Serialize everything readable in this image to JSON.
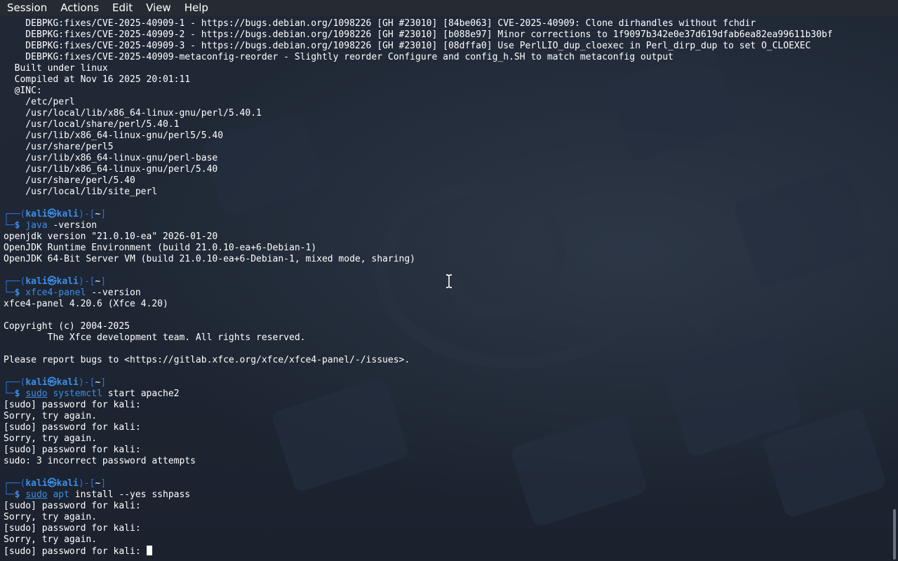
{
  "menubar": {
    "items": [
      "Session",
      "Actions",
      "Edit",
      "View",
      "Help"
    ]
  },
  "colors": {
    "menubar_bg": "#262b33",
    "terminal_text": "#ffffff",
    "prompt_accent": "#2f6fd6",
    "command_accent": "#3d8ee8"
  },
  "icons": {
    "text_cursor": "ibeam-mouse-cursor-icon",
    "terminal_cursor": "block-cursor-icon"
  },
  "terminal": {
    "lines": [
      {
        "t": "plain",
        "text": "    DEBPKG:fixes/CVE-2025-40909-1 - https://bugs.debian.org/1098226 [GH #23010] [84be063] CVE-2025-40909: Clone dirhandles without fchdir"
      },
      {
        "t": "plain",
        "text": "    DEBPKG:fixes/CVE-2025-40909-2 - https://bugs.debian.org/1098226 [GH #23010] [b088e97] Minor corrections to 1f9097b342e0e37d619dfab6ea82ea99611b30bf"
      },
      {
        "t": "plain",
        "text": "    DEBPKG:fixes/CVE-2025-40909-3 - https://bugs.debian.org/1098226 [GH #23010] [08dffa0] Use PerlLIO_dup_cloexec in Perl_dirp_dup to set O_CLOEXEC"
      },
      {
        "t": "plain",
        "text": "    DEBPKG:fixes/CVE-2025-40909-metaconfig-reorder - Slightly reorder Configure and config_h.SH to match metaconfig output"
      },
      {
        "t": "plain",
        "text": "  Built under linux"
      },
      {
        "t": "plain",
        "text": "  Compiled at Nov 16 2025 20:01:11"
      },
      {
        "t": "plain",
        "text": "  @INC:"
      },
      {
        "t": "plain",
        "text": "    /etc/perl"
      },
      {
        "t": "plain",
        "text": "    /usr/local/lib/x86_64-linux-gnu/perl/5.40.1"
      },
      {
        "t": "plain",
        "text": "    /usr/local/share/perl/5.40.1"
      },
      {
        "t": "plain",
        "text": "    /usr/lib/x86_64-linux-gnu/perl5/5.40"
      },
      {
        "t": "plain",
        "text": "    /usr/share/perl5"
      },
      {
        "t": "plain",
        "text": "    /usr/lib/x86_64-linux-gnu/perl-base"
      },
      {
        "t": "plain",
        "text": "    /usr/lib/x86_64-linux-gnu/perl/5.40"
      },
      {
        "t": "plain",
        "text": "    /usr/share/perl/5.40"
      },
      {
        "t": "plain",
        "text": "    /usr/local/lib/site_perl"
      },
      {
        "t": "blank",
        "text": ""
      },
      {
        "t": "prompt",
        "user": "kali",
        "host": "kali",
        "dir": "~"
      },
      {
        "t": "cmd",
        "sudo": "",
        "cmd": "java",
        "args": " -version"
      },
      {
        "t": "plain",
        "text": "openjdk version \"21.0.10-ea\" 2026-01-20"
      },
      {
        "t": "plain",
        "text": "OpenJDK Runtime Environment (build 21.0.10-ea+6-Debian-1)"
      },
      {
        "t": "plain",
        "text": "OpenJDK 64-Bit Server VM (build 21.0.10-ea+6-Debian-1, mixed mode, sharing)"
      },
      {
        "t": "blank",
        "text": ""
      },
      {
        "t": "prompt",
        "user": "kali",
        "host": "kali",
        "dir": "~"
      },
      {
        "t": "cmd",
        "sudo": "",
        "cmd": "xfce4-panel",
        "args": " --version"
      },
      {
        "t": "plain",
        "text": "xfce4-panel 4.20.6 (Xfce 4.20)"
      },
      {
        "t": "blank",
        "text": ""
      },
      {
        "t": "plain",
        "text": "Copyright (c) 2004-2025"
      },
      {
        "t": "plain",
        "text": "        The Xfce development team. All rights reserved."
      },
      {
        "t": "blank",
        "text": ""
      },
      {
        "t": "plain",
        "text": "Please report bugs to <https://gitlab.xfce.org/xfce/xfce4-panel/-/issues>."
      },
      {
        "t": "blank",
        "text": ""
      },
      {
        "t": "prompt",
        "user": "kali",
        "host": "kali",
        "dir": "~"
      },
      {
        "t": "cmd",
        "sudo": "sudo",
        "cmd": "systemctl",
        "args": " start apache2"
      },
      {
        "t": "plain",
        "text": "[sudo] password for kali:"
      },
      {
        "t": "plain",
        "text": "Sorry, try again."
      },
      {
        "t": "plain",
        "text": "[sudo] password for kali:"
      },
      {
        "t": "plain",
        "text": "Sorry, try again."
      },
      {
        "t": "plain",
        "text": "[sudo] password for kali:"
      },
      {
        "t": "plain",
        "text": "sudo: 3 incorrect password attempts"
      },
      {
        "t": "blank",
        "text": ""
      },
      {
        "t": "prompt",
        "user": "kali",
        "host": "kali",
        "dir": "~"
      },
      {
        "t": "cmd",
        "sudo": "sudo",
        "cmd": "apt",
        "args": " install --yes sshpass"
      },
      {
        "t": "plain",
        "text": "[sudo] password for kali:"
      },
      {
        "t": "plain",
        "text": "Sorry, try again."
      },
      {
        "t": "plain",
        "text": "[sudo] password for kali:"
      },
      {
        "t": "plain",
        "text": "Sorry, try again."
      },
      {
        "t": "input",
        "text": "[sudo] password for kali: "
      }
    ]
  }
}
